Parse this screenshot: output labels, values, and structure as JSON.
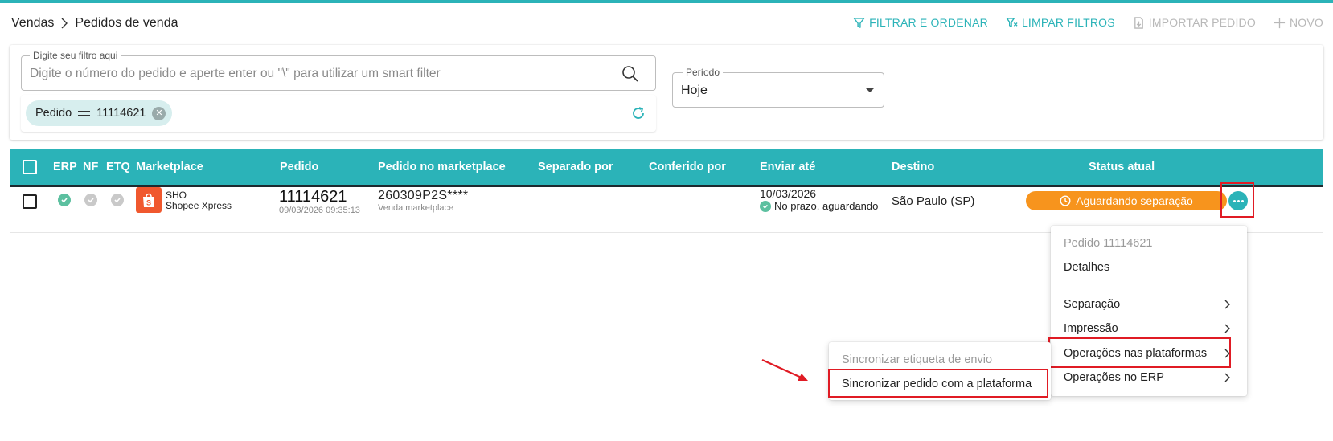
{
  "breadcrumb": {
    "parent": "Vendas",
    "current": "Pedidos de venda"
  },
  "toolbar": {
    "filter_label": "FILTRAR E ORDENAR",
    "clear_label": "LIMPAR FILTROS",
    "import_label": "IMPORTAR PEDIDO",
    "new_label": "NOVO"
  },
  "search": {
    "legend": "Digite seu filtro aqui",
    "placeholder": "Digite o número do pedido e aperte enter ou  \"\\\" para utilizar um smart filter"
  },
  "chip": {
    "field": "Pedido",
    "value": "11114621"
  },
  "period": {
    "legend": "Período",
    "value": "Hoje"
  },
  "table": {
    "columns": {
      "erp": "ERP",
      "nf": "NF",
      "etq": "ETQ",
      "marketplace": "Marketplace",
      "pedido": "Pedido",
      "pedido_mk": "Pedido no marketplace",
      "separado": "Separado por",
      "conferido": "Conferido por",
      "enviar": "Enviar até",
      "destino": "Destino",
      "status": "Status atual"
    },
    "row": {
      "erp_ok": true,
      "nf_ok": false,
      "etq_ok": false,
      "marketplace_code": "SHO",
      "marketplace_name": "Shopee Xpress",
      "pedido": "11114621",
      "pedido_datetime": "09/03/2026 09:35:13",
      "pedido_mk": "260309P2S****",
      "pedido_mk_sub": "Venda marketplace",
      "enviar_date": "10/03/2026",
      "prazo": "No prazo, aguardando",
      "destino": "São Paulo (SP)",
      "status": "Aguardando separação"
    }
  },
  "context_menu": {
    "title": "Pedido 11114621",
    "items": [
      "Detalhes",
      "Separação",
      "Impressão",
      "Operações nas plataformas",
      "Operações no ERP"
    ]
  },
  "submenu": {
    "items": [
      "Sincronizar etiqueta de envio",
      "Sincronizar pedido com a plataforma"
    ]
  },
  "colors": {
    "accent": "#2bb3b8",
    "status": "#f7941d",
    "highlight": "#e01b24",
    "shopee": "#f0582e"
  }
}
